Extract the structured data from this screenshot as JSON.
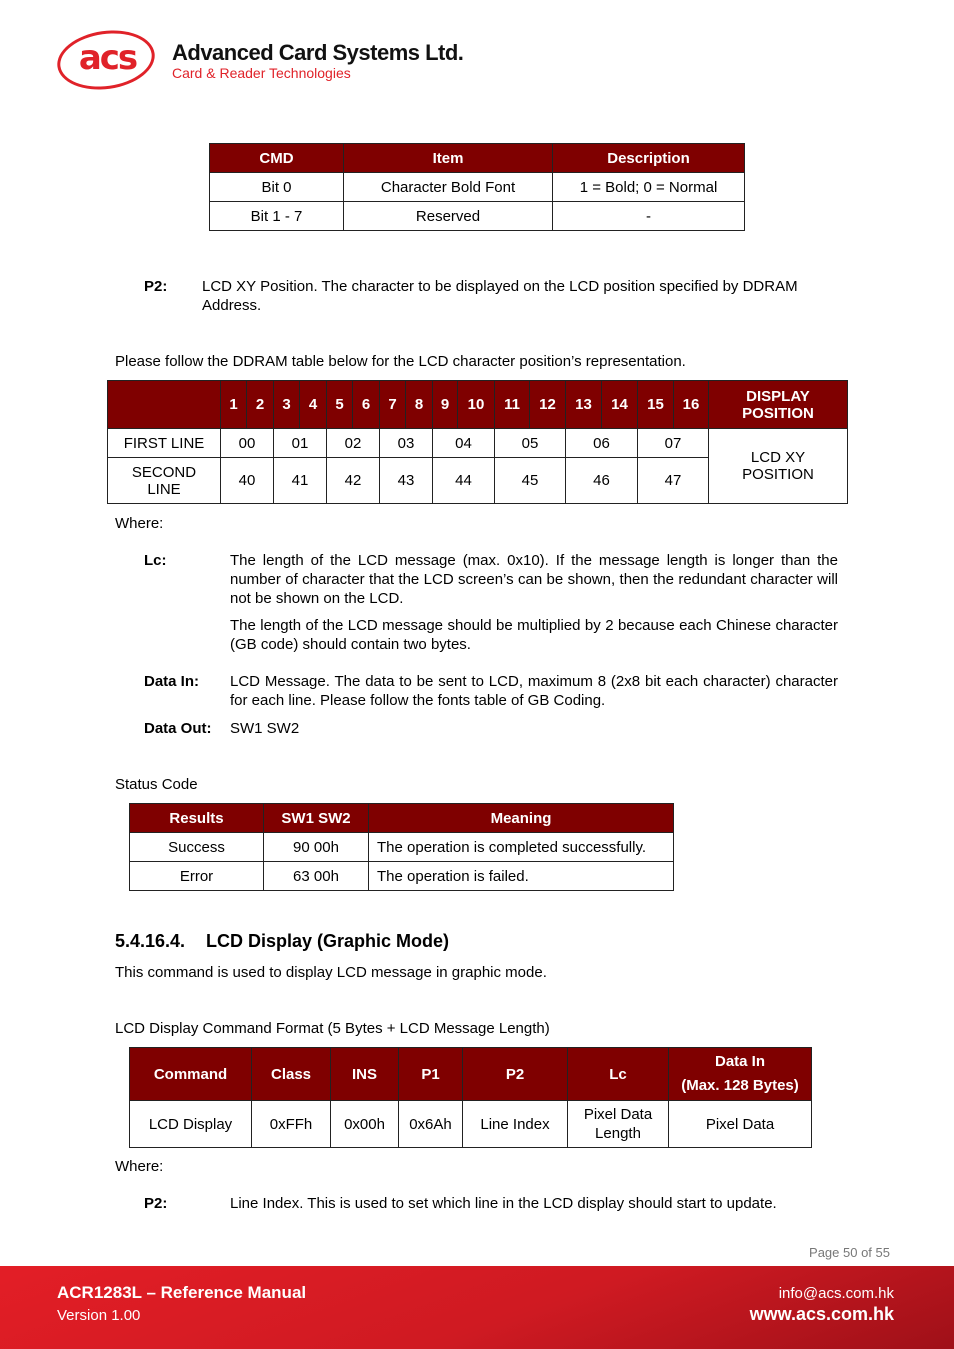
{
  "header": {
    "logo_text": "acs",
    "company": "Advanced Card Systems Ltd.",
    "tagline": "Card & Reader Technologies"
  },
  "cmd_table": {
    "headers": [
      "CMD",
      "Item",
      "Description"
    ],
    "rows": [
      [
        "Bit 0",
        "Character Bold Font",
        "1 = Bold; 0 = Normal"
      ],
      [
        "Bit 1 - 7",
        "Reserved",
        "-"
      ]
    ]
  },
  "p2_def": {
    "label": "P2:",
    "text": "LCD XY Position. The character to be displayed on the LCD position specified by DDRAM Address."
  },
  "ddram_intro": "Please follow the DDRAM table below for the LCD character position’s representation.",
  "ddram_table": {
    "corner": "",
    "columns": [
      "1",
      "2",
      "3",
      "4",
      "5",
      "6",
      "7",
      "8",
      "9",
      "10",
      "11",
      "12",
      "13",
      "14",
      "15",
      "16"
    ],
    "display_header": "DISPLAY POSITION",
    "rows": [
      {
        "label": "FIRST LINE",
        "values": [
          "00",
          "01",
          "02",
          "03",
          "04",
          "05",
          "06",
          "07"
        ]
      },
      {
        "label": "SECOND LINE",
        "values": [
          "40",
          "41",
          "42",
          "43",
          "44",
          "45",
          "46",
          "47"
        ]
      }
    ],
    "display_value": "LCD XY POSITION"
  },
  "where1": "Where:",
  "defs": [
    {
      "label": "Lc:",
      "text": "The length of the LCD message (max. 0x10). If the message length is longer than the number of character that the LCD screen’s can be shown, then the redundant character will not be shown on the LCD."
    },
    {
      "label": "",
      "text": "The length of the LCD message should be multiplied by 2 because each Chinese character (GB code) should contain two bytes."
    },
    {
      "label": "Data In:",
      "text": "LCD Message. The data to be sent to LCD, maximum 8 (2x8 bit each character) character for each line. Please follow the fonts table of GB Coding."
    },
    {
      "label": "Data Out:",
      "text": "SW1 SW2"
    }
  ],
  "status_title": "Status Code",
  "status_table": {
    "headers": [
      "Results",
      "SW1 SW2",
      "Meaning"
    ],
    "rows": [
      [
        "Success",
        "90 00h",
        "The operation is completed successfully."
      ],
      [
        "Error",
        "63 00h",
        "The operation is failed."
      ]
    ]
  },
  "section": {
    "number": "5.4.16.4.",
    "title": "LCD Display (Graphic Mode)",
    "desc": "This command is used to display LCD message in graphic mode."
  },
  "format_title": "LCD Display Command Format (5 Bytes + LCD Message Length)",
  "format_table": {
    "headers": [
      "Command",
      "Class",
      "INS",
      "P1",
      "P2",
      "Lc",
      "Data In",
      "(Max. 128 Bytes)"
    ],
    "row": [
      "LCD Display",
      "0xFFh",
      "0x00h",
      "0x6Ah",
      "Line Index",
      "Pixel Data Length",
      "Pixel Data"
    ]
  },
  "where2": "Where:",
  "p2_graphic": {
    "label": "P2:",
    "text": "Line Index. This is used to set which line in the LCD display should start to update."
  },
  "page_number": "Page 50 of 55",
  "footer": {
    "title": "ACR1283L – Reference Manual",
    "version": "Version 1.00",
    "email": "info@acs.com.hk",
    "website": "www.acs.com.hk"
  }
}
